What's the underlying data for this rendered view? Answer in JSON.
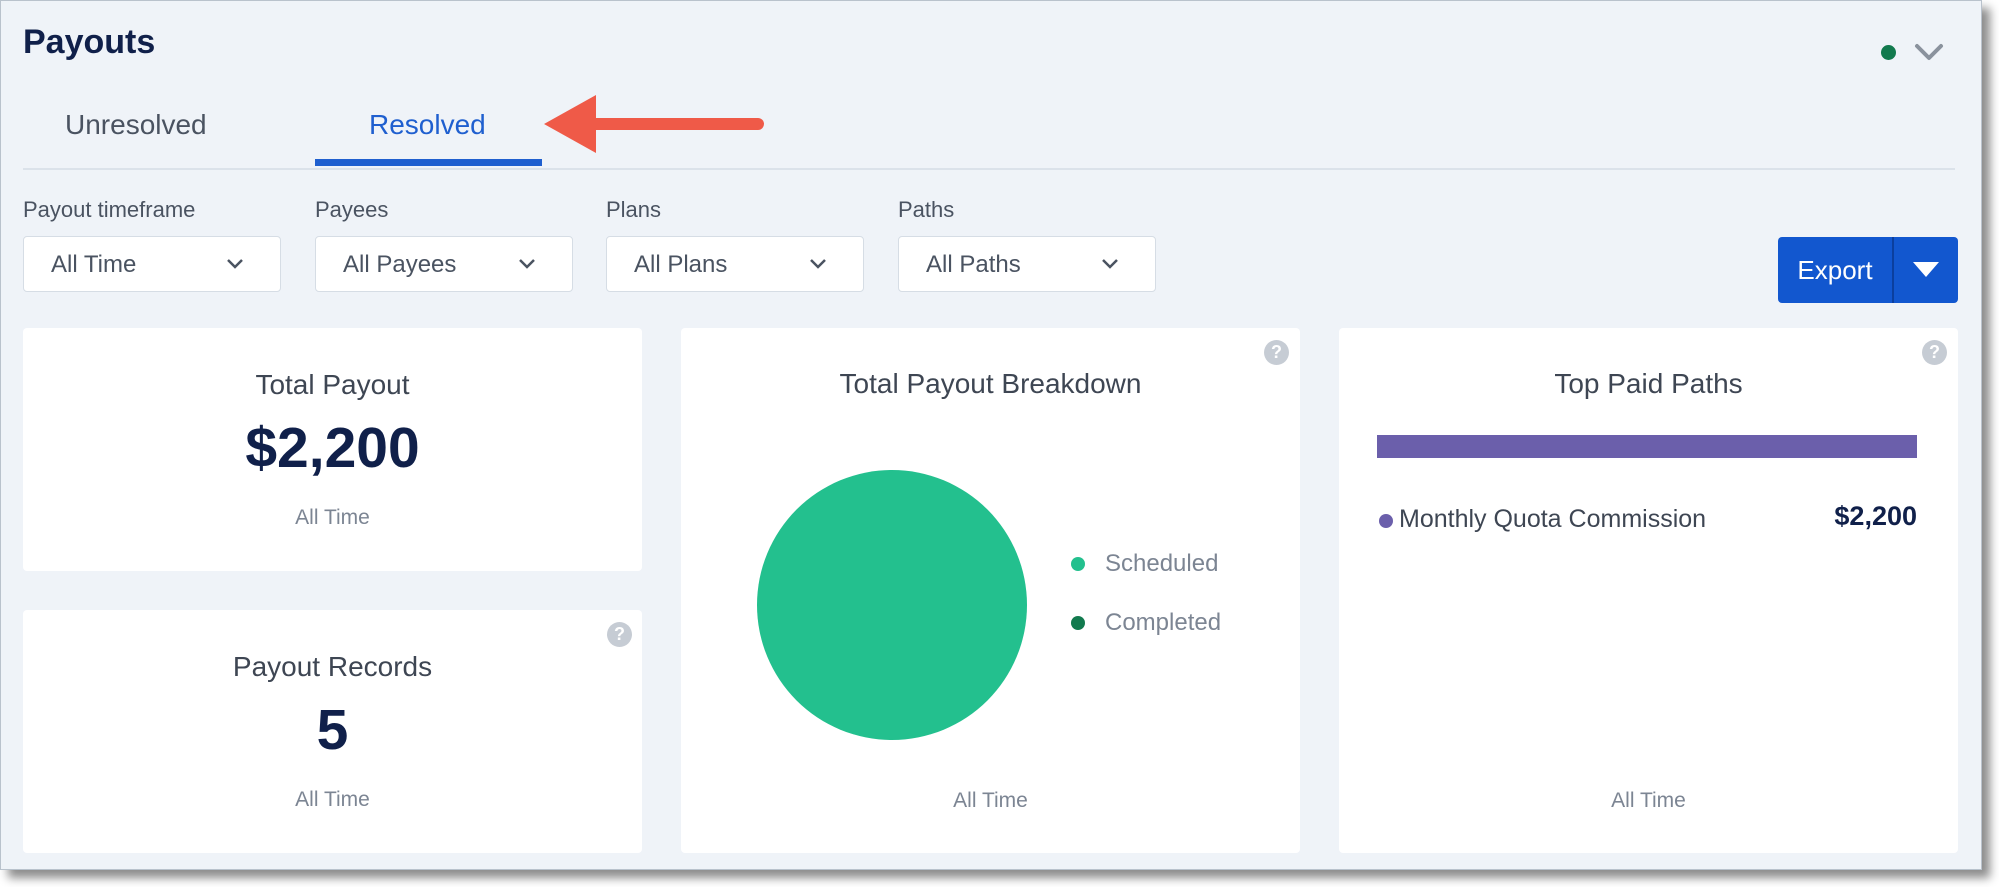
{
  "header": {
    "title": "Payouts"
  },
  "tabs": [
    {
      "label": "Unresolved",
      "active": false
    },
    {
      "label": "Resolved",
      "active": true
    }
  ],
  "filters": [
    {
      "label": "Payout timeframe",
      "value": "All Time"
    },
    {
      "label": "Payees",
      "value": "All Payees"
    },
    {
      "label": "Plans",
      "value": "All Plans"
    },
    {
      "label": "Paths",
      "value": "All Paths"
    }
  ],
  "export": {
    "label": "Export"
  },
  "cards": {
    "total_payout": {
      "title": "Total Payout",
      "value": "$2,200",
      "period": "All Time"
    },
    "payout_records": {
      "title": "Payout Records",
      "value": "5",
      "period": "All Time",
      "help": "?"
    },
    "breakdown": {
      "title": "Total Payout Breakdown",
      "period": "All Time",
      "help": "?",
      "legend": [
        {
          "label": "Scheduled",
          "color": "#23c08e"
        },
        {
          "label": "Completed",
          "color": "#127a4e"
        }
      ]
    },
    "top_paths": {
      "title": "Top Paid Paths",
      "period": "All Time",
      "help": "?",
      "bar_fraction": 1.0,
      "items": [
        {
          "name": "Monthly Quota Commission",
          "amount": "$2,200"
        }
      ]
    }
  },
  "colors": {
    "brand_blue": "#1257cf",
    "navy_text": "#10204a",
    "scheduled": "#23c08e",
    "completed": "#127a4e",
    "path_purple": "#6b5fab",
    "annotation_arrow": "#ef5a48"
  },
  "icons": [
    "chevron-down-icon",
    "help-icon",
    "caret-down-icon",
    "annotation-arrow",
    "status-dot"
  ]
}
